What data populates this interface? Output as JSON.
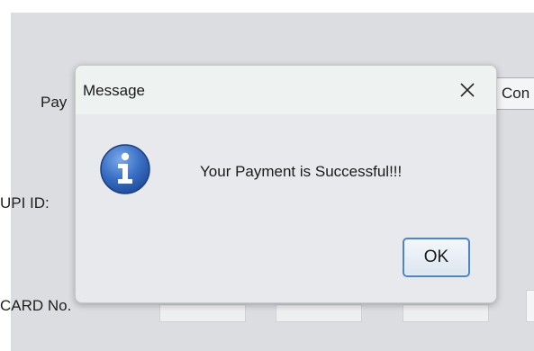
{
  "background": {
    "payment_label": "Pay",
    "upi_label": "UPI ID:",
    "card_label": "CARD No.",
    "confirm_button": "Con"
  },
  "dialog": {
    "title": "Message",
    "close_glyph": "×",
    "icon": "info-icon",
    "message": "Your Payment is Successful!!!",
    "ok_label": "OK"
  },
  "colors": {
    "dialog_bg": "#e7e9ec",
    "titlebar_bg": "#eef2f1",
    "info_icon_blue": "#2f63b8",
    "ok_border": "#4d86c7"
  }
}
